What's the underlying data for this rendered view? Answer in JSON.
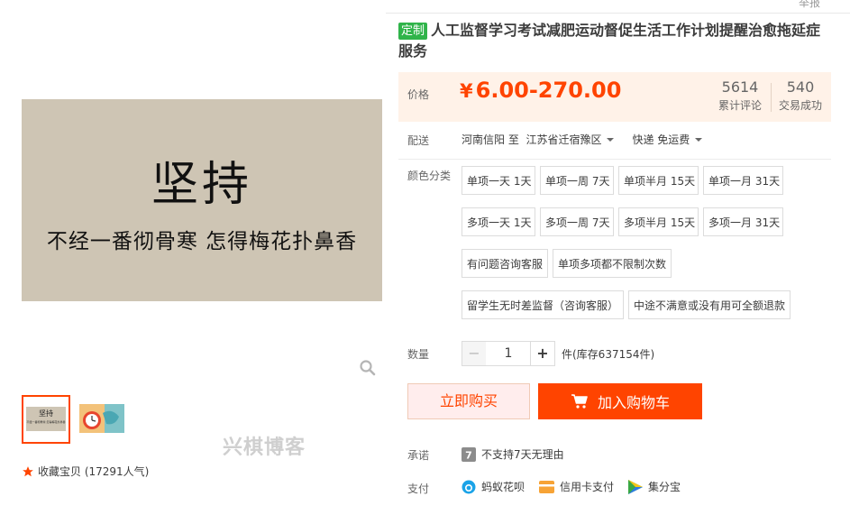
{
  "report_label": "举报",
  "gallery": {
    "main_title": "坚持",
    "main_subtitle": "不经一番彻骨寒  怎得梅花扑鼻香",
    "thumb1_title": "坚持",
    "thumb1_sub": "不经一番彻骨寒 怎得梅花扑鼻香",
    "watermark": "兴棋博客",
    "favorite_label": "收藏宝贝 (17291人气)"
  },
  "product": {
    "tag": "定制",
    "title": "人工监督学习考试减肥运动督促生活工作计划提醒治愈拖延症服务"
  },
  "price": {
    "label": "价格",
    "currency": "¥",
    "value": "6.00-270.00",
    "reviews_count": "5614",
    "reviews_label": "累计评论",
    "deals_count": "540",
    "deals_label": "交易成功"
  },
  "shipping": {
    "label": "配送",
    "from": "河南信阳 至",
    "to": "江苏省迁宿豫区",
    "method": "快递 免运费"
  },
  "options": {
    "label": "颜色分类",
    "items": [
      "单项一天 1天",
      "单项一周 7天",
      "单项半月 15天",
      "单项一月 31天",
      "多项一天 1天",
      "多项一周 7天",
      "多项半月 15天",
      "多项一月 31天",
      "有问题咨询客服",
      "单项多项都不限制次数",
      "留学生无时差监督（咨询客服）",
      "中途不满意或没有用可全额退款"
    ]
  },
  "quantity": {
    "label": "数量",
    "minus": "−",
    "value": "1",
    "plus": "+",
    "stock": "件(库存637154件)"
  },
  "actions": {
    "buy_now": "立即购买",
    "add_to_cart": "加入购物车"
  },
  "promise": {
    "label": "承诺",
    "text": "不支持7天无理由"
  },
  "payment": {
    "label": "支付",
    "methods": [
      "蚂蚁花呗",
      "信用卡支付",
      "集分宝"
    ]
  },
  "colors": {
    "accent": "#ff4400",
    "tag_green": "#30b44a",
    "price_bg": "#fff2e8"
  }
}
